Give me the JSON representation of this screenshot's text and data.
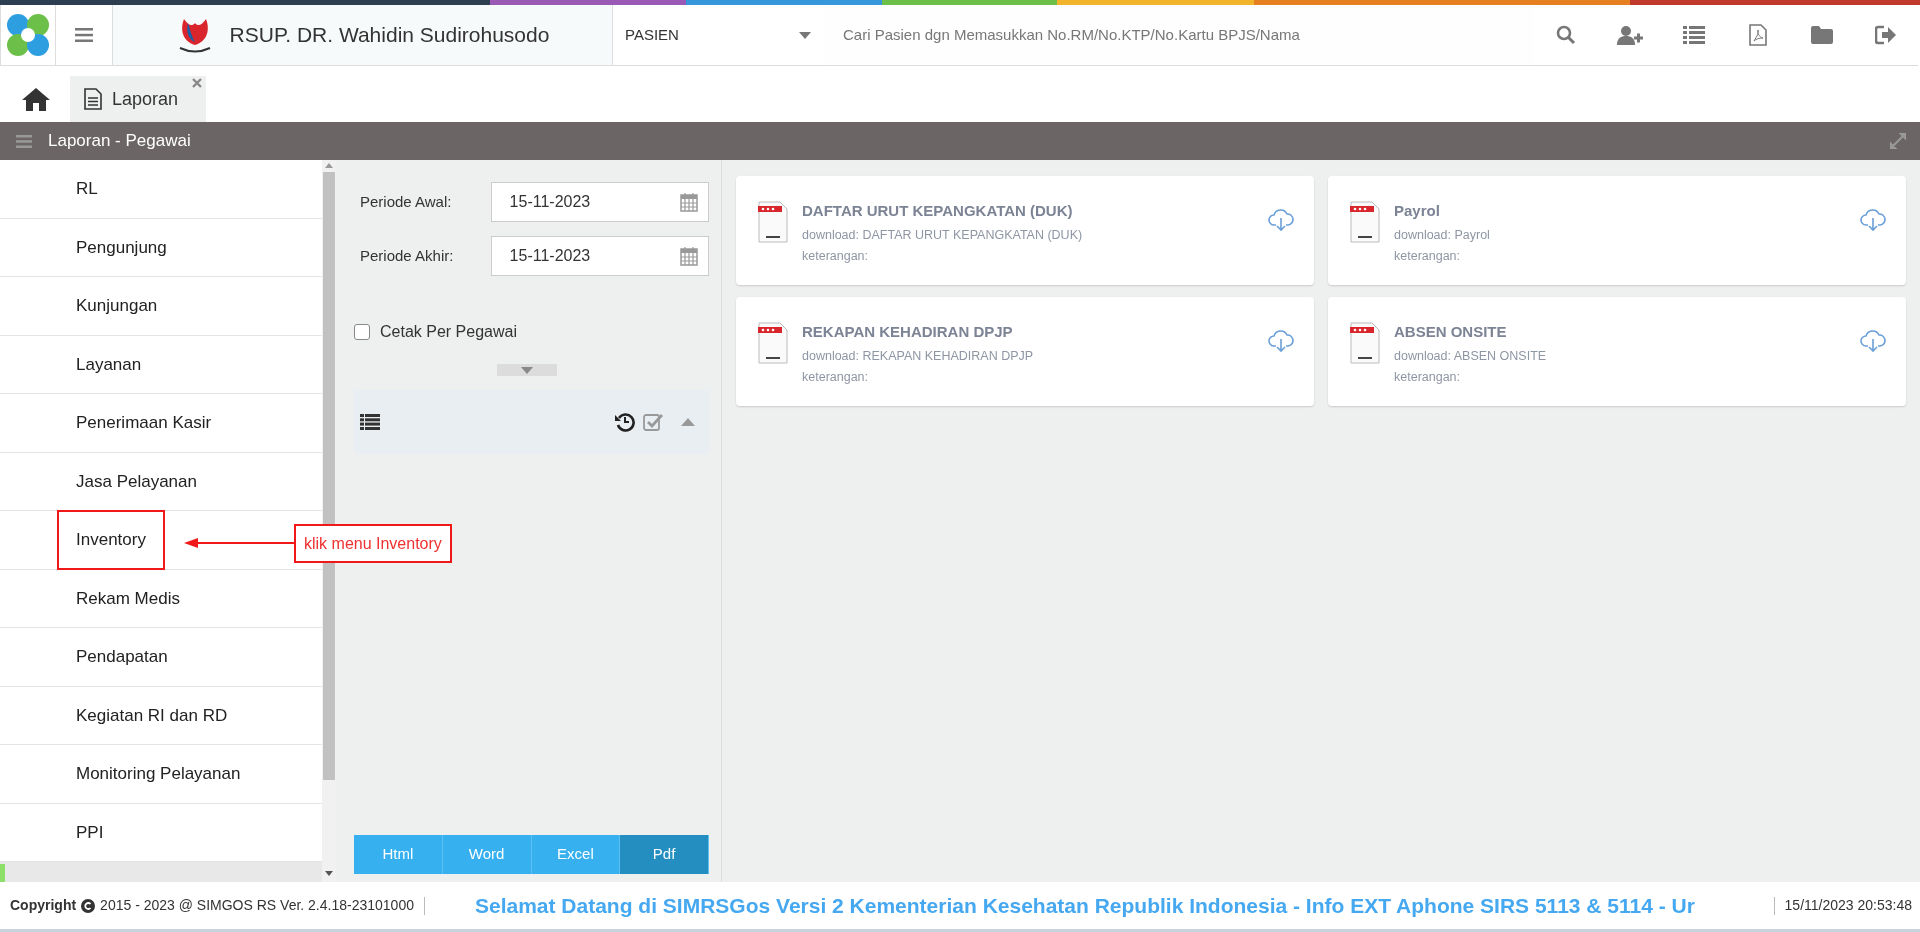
{
  "header": {
    "hospital_name": "RSUP. DR. Wahidin Sudirohusodo",
    "search_category": "PASIEN",
    "search_placeholder": "Cari Pasien dgn Memasukkan No.RM/No.KTP/No.Kartu BPJS/Nama"
  },
  "tabs": [
    {
      "label": "Laporan",
      "selected": true
    }
  ],
  "panel": {
    "title": "Laporan - Pegawai"
  },
  "sidebar": {
    "items": [
      {
        "label": "RL",
        "annotated": false
      },
      {
        "label": "Pengunjung",
        "annotated": false
      },
      {
        "label": "Kunjungan",
        "annotated": false
      },
      {
        "label": "Layanan",
        "annotated": false
      },
      {
        "label": "Penerimaan Kasir",
        "annotated": false
      },
      {
        "label": "Jasa Pelayanan",
        "annotated": false
      },
      {
        "label": "Inventory",
        "annotated": true
      },
      {
        "label": "Rekam Medis",
        "annotated": false
      },
      {
        "label": "Pendapatan",
        "annotated": false
      },
      {
        "label": "Kegiatan RI dan RD",
        "annotated": false
      },
      {
        "label": "Monitoring Pelayanan",
        "annotated": false
      },
      {
        "label": "PPI",
        "annotated": false
      }
    ]
  },
  "annotation": {
    "text": "klik menu Inventory"
  },
  "filters": [
    {
      "label": "Periode Awal:",
      "value": "15-11-2023"
    },
    {
      "label": "Periode Akhir:",
      "value": "15-11-2023"
    }
  ],
  "print_per_employee": {
    "label": "Cetak Per Pegawai",
    "checked": false
  },
  "export_buttons": [
    {
      "label": "Html",
      "selected": false
    },
    {
      "label": "Word",
      "selected": false
    },
    {
      "label": "Excel",
      "selected": false
    },
    {
      "label": "Pdf",
      "selected": true
    }
  ],
  "reports": [
    {
      "title": "DAFTAR URUT KEPANGKATAN (DUK)",
      "download": "download: DAFTAR URUT KEPANGKATAN (DUK)",
      "note": "keterangan:"
    },
    {
      "title": "Payrol",
      "download": "download: Payrol",
      "note": "keterangan:"
    },
    {
      "title": "REKAPAN KEHADIRAN DPJP",
      "download": "download: REKAPAN KEHADIRAN DPJP",
      "note": "keterangan:"
    },
    {
      "title": "ABSEN ONSITE",
      "download": "download: ABSEN ONSITE",
      "note": "keterangan:"
    }
  ],
  "footer": {
    "copyright_label": "Copyright",
    "copyright_text": "2015 - 2023 @ SIMGOS RS Ver. 2.4.18-23101000",
    "news": "Selamat Datang di SIMRSGos Versi 2 Kementerian Kesehatan Republik Indonesia - Info EXT Aphone SIRS 5113 & 5114 - Ur",
    "datetime": "15/11/2023 20:53:48"
  }
}
